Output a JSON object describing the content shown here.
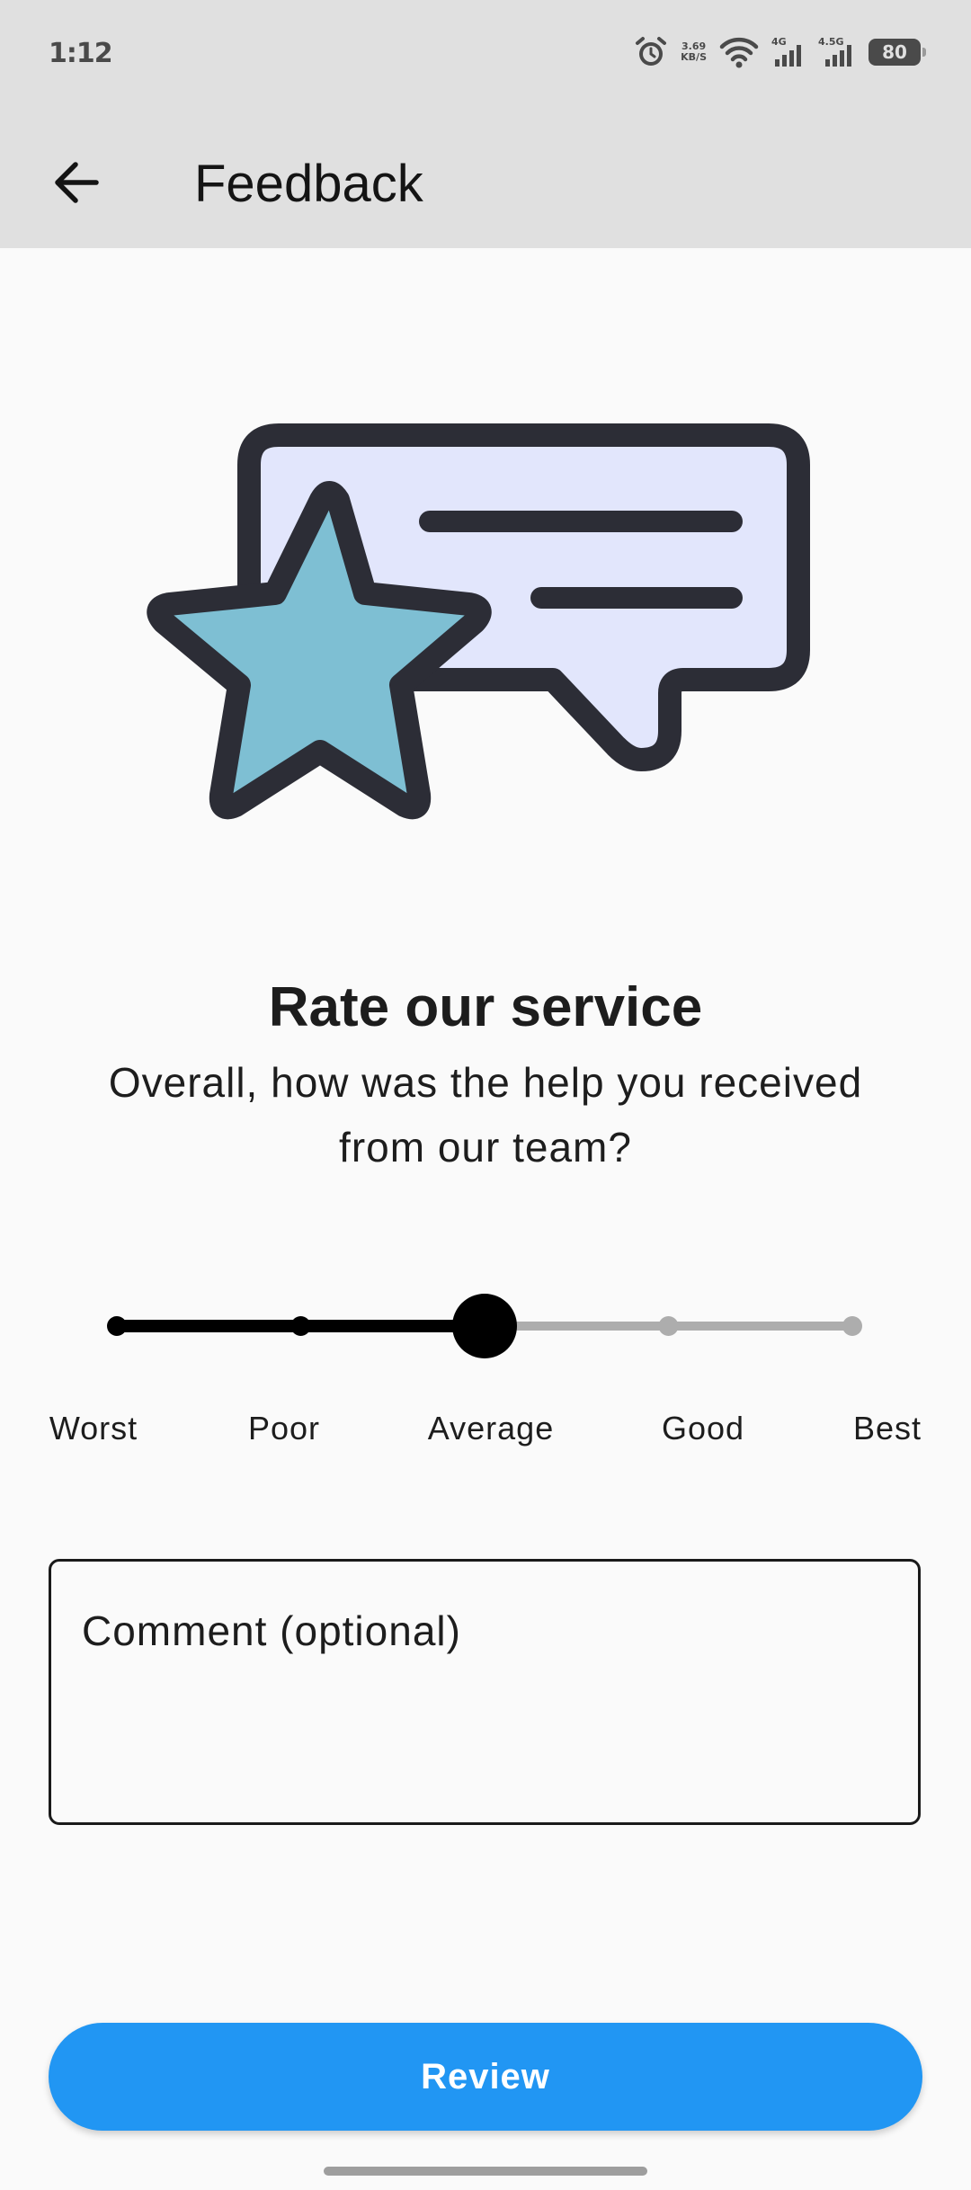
{
  "status_bar": {
    "time": "1:12",
    "net_speed_value": "3.69",
    "net_speed_unit": "KB/S",
    "signal_1_label": "4G",
    "signal_2_label": "4.5G",
    "battery": "80",
    "icons": [
      "alarm-icon",
      "wifi-icon",
      "signal-icon",
      "signal-icon",
      "battery-icon"
    ]
  },
  "app_bar": {
    "title": "Feedback",
    "back_icon": "arrow-left-icon"
  },
  "illustration": {
    "icon": "star-speech-bubble-icon",
    "colors": {
      "star_fill": "#7ebfd3",
      "bubble_fill": "#e2e6fc",
      "outline": "#2c2d36"
    }
  },
  "rating": {
    "title": "Rate our service",
    "subtitle_line1": "Overall, how was the help you received",
    "subtitle_line2": "from our team?",
    "options": [
      "Worst",
      "Poor",
      "Average",
      "Good",
      "Best"
    ],
    "selected_index": 2,
    "selected_label": "Average",
    "colors": {
      "active": "#000000",
      "inactive": "#adadad"
    }
  },
  "comment": {
    "placeholder": "Comment (optional)",
    "value": ""
  },
  "review_button": {
    "label": "Review",
    "color": "#2196f3"
  }
}
